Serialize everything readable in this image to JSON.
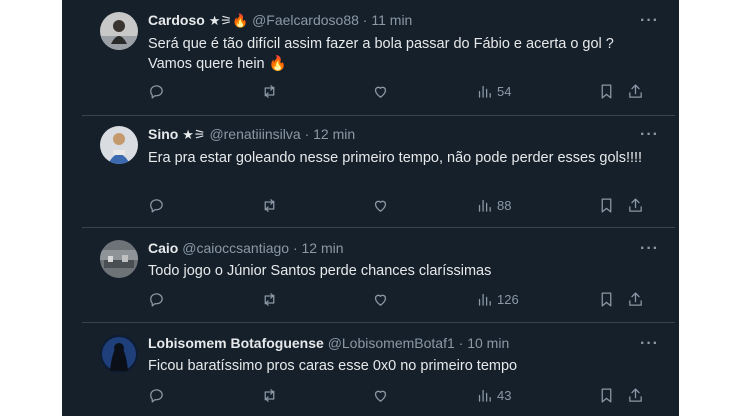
{
  "tweets": [
    {
      "name": "Cardoso",
      "badges": "★⚞🔥",
      "handle": "@Faelcardoso88",
      "sep": "·",
      "time": "11 min",
      "text": "Será que é tão difícil assim fazer a bola passar do Fábio e acerta o gol ? Vamos quere hein 🔥",
      "views": "54"
    },
    {
      "name": "Sino",
      "badges": "★⚞",
      "handle": "@renatiiinsilva",
      "sep": "·",
      "time": "12 min",
      "text": "Era pra estar goleando nesse primeiro tempo, não pode perder esses gols!!!!",
      "views": "88"
    },
    {
      "name": "Caio",
      "badges": "",
      "handle": "@caioccsantiago",
      "sep": "·",
      "time": "12 min",
      "text": "Todo jogo o Júnior Santos perde chances claríssimas",
      "views": "126"
    },
    {
      "name": "Lobisomem Botafoguense",
      "badges": "",
      "handle": "@LobisomemBotaf1",
      "sep": "·",
      "time": "10 min",
      "text": "Ficou baratíssimo pros caras esse 0x0 no primeiro tempo",
      "views": "43"
    }
  ],
  "more_icon": "···",
  "colors": {
    "background": "#15202b",
    "text": "#e7e9ea",
    "secondary": "#8b98a5",
    "divider": "#38444d"
  }
}
